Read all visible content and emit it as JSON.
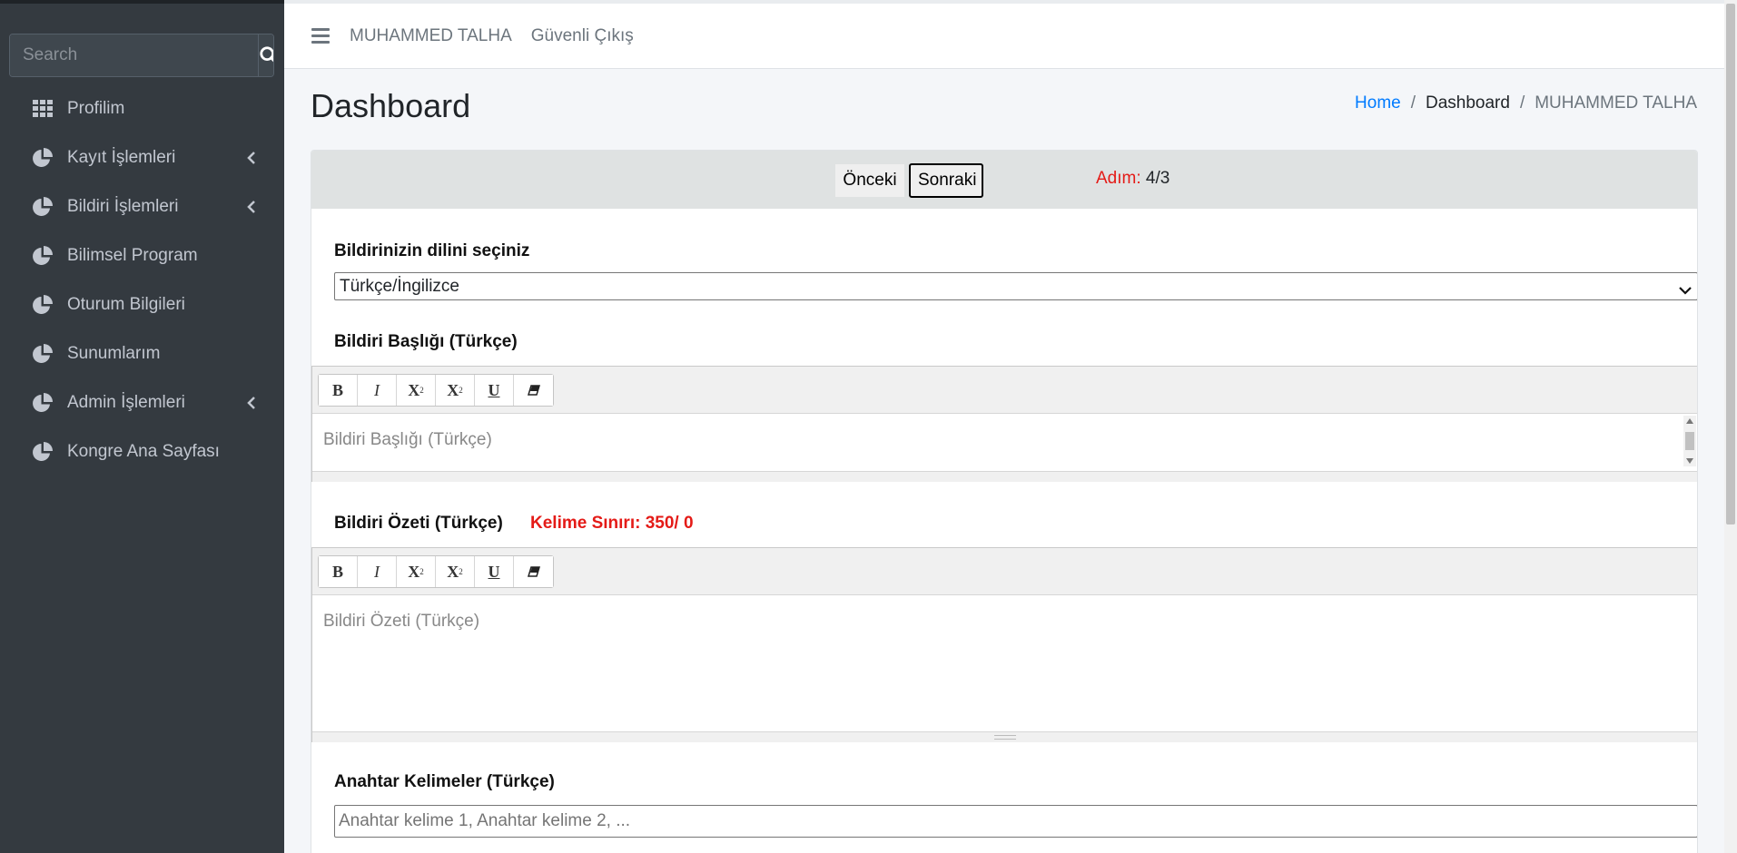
{
  "sidebar": {
    "search": {
      "placeholder": "Search"
    },
    "items": [
      {
        "label": "Profilim",
        "icon": "grid-icon",
        "has_children": false
      },
      {
        "label": "Kayıt İşlemleri",
        "icon": "chart-pie-icon",
        "has_children": true
      },
      {
        "label": "Bildiri İşlemleri",
        "icon": "chart-pie-icon",
        "has_children": true
      },
      {
        "label": "Bilimsel Program",
        "icon": "chart-pie-icon",
        "has_children": false
      },
      {
        "label": "Oturum Bilgileri",
        "icon": "chart-pie-icon",
        "has_children": false
      },
      {
        "label": "Sunumlarım",
        "icon": "chart-pie-icon",
        "has_children": false
      },
      {
        "label": "Admin İşlemleri",
        "icon": "chart-pie-icon",
        "has_children": true
      },
      {
        "label": "Kongre Ana Sayfası",
        "icon": "chart-pie-icon",
        "has_children": false
      }
    ]
  },
  "topbar": {
    "user_name": "MUHAMMED TALHA",
    "logout_label": "Güvenli Çıkış"
  },
  "header": {
    "title": "Dashboard",
    "breadcrumb": [
      "Home",
      "Dashboard",
      "MUHAMMED TALHA"
    ]
  },
  "stepper": {
    "prev_label": "Önceki",
    "next_label": "Sonraki",
    "step_prefix": "Adım:",
    "step_value": "4/3"
  },
  "form": {
    "language": {
      "label": "Bildirinizin dilini seçiniz",
      "selected": "Türkçe/İngilizce"
    },
    "title_tr": {
      "label": "Bildiri Başlığı (Türkçe)",
      "placeholder": "Bildiri Başlığı (Türkçe)"
    },
    "abstract_tr": {
      "label": "Bildiri Özeti (Türkçe)",
      "word_limit": "Kelime Sınırı: 350/ 0",
      "placeholder": "Bildiri Özeti (Türkçe)"
    },
    "keywords_tr": {
      "label": "Anahtar Kelimeler (Türkçe)",
      "placeholder": "Anahtar kelime 1, Anahtar kelime 2, ..."
    },
    "toolbar_buttons": [
      {
        "name": "bold-button",
        "glyph": "B"
      },
      {
        "name": "italic-button",
        "glyph": "I"
      },
      {
        "name": "superscript-button",
        "glyph": "X"
      },
      {
        "name": "subscript-button",
        "glyph": "X"
      },
      {
        "name": "underline-button",
        "glyph": "U"
      },
      {
        "name": "clear-format-button",
        "glyph": "eraser"
      }
    ]
  },
  "colors": {
    "sidebar_bg": "#343a40",
    "link_blue": "#007bff",
    "alert_red": "#e41b17"
  }
}
